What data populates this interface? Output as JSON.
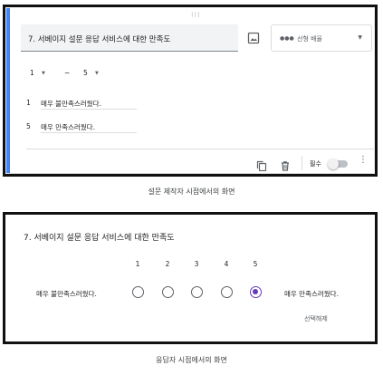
{
  "editor": {
    "question_title": "7. 서베이지 설문 응답 서비스에 대한 만족도",
    "question_type": "선형 배율",
    "scale": {
      "min": "1",
      "tilde": "~",
      "max": "5"
    },
    "low_label_number": "1",
    "low_label": "매우 불만족스러웠다.",
    "high_label_number": "5",
    "high_label": "매우 만족스러웠다.",
    "required_label": "필수",
    "required_on": false,
    "caption": "설문 제작자 시점에서의 화면"
  },
  "respondent": {
    "question_title": "7. 서베이지 설문 응답 서비스에 대한 만족도",
    "scale_numbers": [
      "1",
      "2",
      "3",
      "4",
      "5"
    ],
    "low_label": "매우 불만족스러웠다.",
    "high_label": "매우 만족스러웠다.",
    "selected_value": "5",
    "clear_selection": "선택해제",
    "caption": "응답자 시점에서의 화면"
  },
  "colors": {
    "accent_blue": "#4285f4",
    "selected_purple": "#673ab7"
  },
  "icons": [
    "drag-handle-icon",
    "image-icon",
    "linear-scale-icon",
    "caret-down-icon",
    "copy-icon",
    "delete-icon",
    "more-vert-icon"
  ]
}
